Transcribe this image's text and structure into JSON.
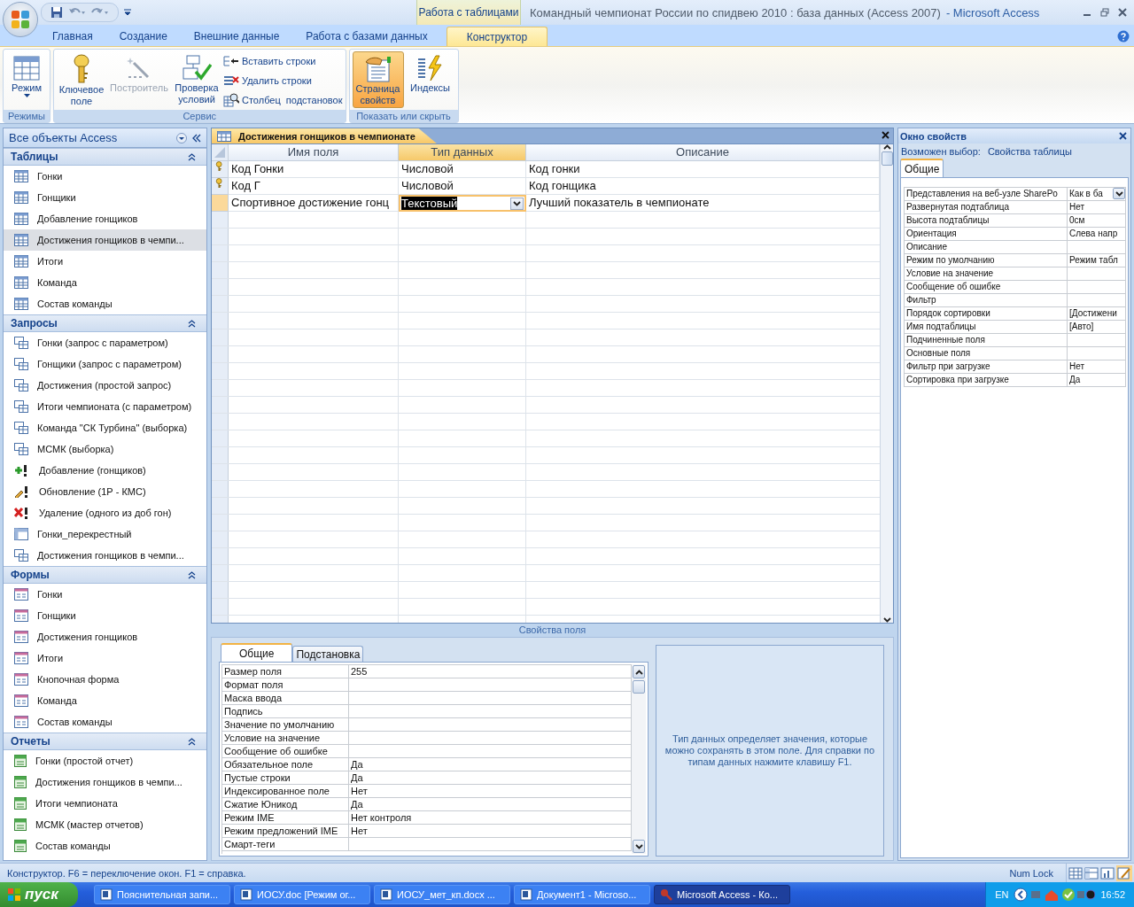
{
  "window": {
    "context_group": "Работа с таблицами",
    "title": "Командный чемпионат России по спидвею 2010 : база данных (Access 2007)",
    "app_name": "- Microsoft Access"
  },
  "ribbon_tabs": [
    {
      "label": "Главная",
      "selected": false
    },
    {
      "label": "Создание",
      "selected": false
    },
    {
      "label": "Внешние данные",
      "selected": false
    },
    {
      "label": "Работа с базами данных",
      "selected": false
    },
    {
      "label": "Конструктор",
      "selected": true
    }
  ],
  "ribbon_groups": [
    {
      "label": "Режимы",
      "items": [
        {
          "label": "Режим",
          "kind": "large",
          "disabled": false,
          "selected": false
        }
      ]
    },
    {
      "label": "Сервис",
      "items": [
        {
          "label": "Ключевое поле",
          "kind": "large",
          "disabled": false,
          "selected": false
        },
        {
          "label": "Построитель",
          "kind": "large",
          "disabled": true,
          "selected": false
        },
        {
          "label": "Проверка условий",
          "kind": "large",
          "disabled": false,
          "selected": false
        },
        {
          "label": "Вставить строки",
          "kind": "small",
          "disabled": false,
          "selected": false
        },
        {
          "label": "Удалить строки",
          "kind": "small",
          "disabled": false,
          "selected": false
        },
        {
          "label": "Столбец  подстановок",
          "kind": "small",
          "disabled": false,
          "selected": false
        }
      ]
    },
    {
      "label": "Показать или скрыть",
      "items": [
        {
          "label": "Страница свойств",
          "kind": "large",
          "disabled": false,
          "selected": true
        },
        {
          "label": "Индексы",
          "kind": "large",
          "disabled": false,
          "selected": false
        }
      ]
    }
  ],
  "nav_pane": {
    "title": "Все объекты Access",
    "sections": [
      {
        "title": "Таблицы",
        "items": [
          {
            "label": "Гонки",
            "kind": "table",
            "selected": false
          },
          {
            "label": "Гонщики",
            "kind": "table",
            "selected": false
          },
          {
            "label": "Добавление гонщиков",
            "kind": "table",
            "selected": false
          },
          {
            "label": "Достижения гонщиков в чемпи...",
            "kind": "table",
            "selected": true
          },
          {
            "label": "Итоги",
            "kind": "table",
            "selected": false
          },
          {
            "label": "Команда",
            "kind": "table",
            "selected": false
          },
          {
            "label": "Состав команды",
            "kind": "table",
            "selected": false
          }
        ]
      },
      {
        "title": "Запросы",
        "items": [
          {
            "label": "Гонки (запрос с параметром)",
            "kind": "query",
            "selected": false
          },
          {
            "label": "Гонщики (запрос с параметром)",
            "kind": "query",
            "selected": false
          },
          {
            "label": "Достижения (простой запрос)",
            "kind": "query",
            "selected": false
          },
          {
            "label": "Итоги чемпионата (с параметром)",
            "kind": "query",
            "selected": false
          },
          {
            "label": "Команда \"СК Турбина\" (выборка)",
            "kind": "query",
            "selected": false
          },
          {
            "label": "МСМК (выборка)",
            "kind": "query",
            "selected": false
          },
          {
            "label": "Добавление (гонщиков)",
            "kind": "append",
            "selected": false
          },
          {
            "label": "Обновление (1Р - КМС)",
            "kind": "update",
            "selected": false
          },
          {
            "label": "Удаление (одного из доб гон)",
            "kind": "delete",
            "selected": false
          },
          {
            "label": "Гонки_перекрестный",
            "kind": "crosstab",
            "selected": false
          },
          {
            "label": "Достижения гонщиков в чемпи...",
            "kind": "query",
            "selected": false
          }
        ]
      },
      {
        "title": "Формы",
        "items": [
          {
            "label": "Гонки",
            "kind": "form",
            "selected": false
          },
          {
            "label": "Гонщики",
            "kind": "form",
            "selected": false
          },
          {
            "label": "Достижения гонщиков",
            "kind": "form",
            "selected": false
          },
          {
            "label": "Итоги",
            "kind": "form",
            "selected": false
          },
          {
            "label": "Кнопочная форма",
            "kind": "form",
            "selected": false
          },
          {
            "label": "Команда",
            "kind": "form",
            "selected": false
          },
          {
            "label": "Состав команды",
            "kind": "form",
            "selected": false
          }
        ]
      },
      {
        "title": "Отчеты",
        "items": [
          {
            "label": "Гонки (простой отчет)",
            "kind": "report",
            "selected": false
          },
          {
            "label": "Достижения гонщиков в чемпи...",
            "kind": "report",
            "selected": false
          },
          {
            "label": "Итоги чемпионата",
            "kind": "report",
            "selected": false
          },
          {
            "label": "МСМК (мастер отчетов)",
            "kind": "report",
            "selected": false
          },
          {
            "label": "Состав команды",
            "kind": "report",
            "selected": false
          }
        ]
      }
    ]
  },
  "document": {
    "tab_title": "Достижения гонщиков в чемпионате",
    "columns": [
      {
        "label": "Имя поля",
        "selected": false
      },
      {
        "label": "Тип данных",
        "selected": true
      },
      {
        "label": "Описание",
        "selected": false
      }
    ],
    "rows": [
      {
        "name": "Код Гонки",
        "type": "Числовой",
        "description": "Код гонки",
        "primary_key": true,
        "selected": false
      },
      {
        "name": "Код Г",
        "type": "Числовой",
        "description": "Код гонщика",
        "primary_key": true,
        "selected": false
      },
      {
        "name": "Спортивное достижение гонц",
        "type": "Текстовый",
        "description": "Лучший показатель в чемпионате",
        "primary_key": false,
        "selected": true
      }
    ]
  },
  "field_properties": {
    "label": "Свойства поля",
    "tabs": [
      {
        "label": "Общие",
        "selected": true
      },
      {
        "label": "Подстановка",
        "selected": false
      }
    ],
    "rows": [
      {
        "name": "Размер поля",
        "value": "255"
      },
      {
        "name": "Формат поля"
      },
      {
        "name": "Маска ввода"
      },
      {
        "name": "Подпись"
      },
      {
        "name": "Значение по умолчанию"
      },
      {
        "name": "Условие на значение"
      },
      {
        "name": "Сообщение об ошибке"
      },
      {
        "name": "Обязательное поле",
        "value": "Да"
      },
      {
        "name": "Пустые строки",
        "value": "Да"
      },
      {
        "name": "Индексированное поле",
        "value": "Нет"
      },
      {
        "name": "Сжатие Юникод",
        "value": "Да"
      },
      {
        "name": "Режим IME",
        "value": "Нет контроля"
      },
      {
        "name": "Режим предложений IME",
        "value": "Нет"
      },
      {
        "name": "Смарт-теги"
      }
    ],
    "help": "Тип данных определяет значения, которые можно сохранять в этом поле.  Для справки по типам данных нажмите клавишу F1."
  },
  "property_sheet": {
    "title": "Окно свойств",
    "selection_label": "Возможен выбор:",
    "selection": "Свойства таблицы",
    "tabs": [
      {
        "label": "Общие",
        "selected": true
      }
    ],
    "rows": [
      {
        "name": "Представления на веб-узле SharePo",
        "value": "Как в ба",
        "kind": "combo"
      },
      {
        "name": "Развернутая подтаблица",
        "value": "Нет",
        "kind": "text"
      },
      {
        "name": "Высота подтаблицы",
        "value": "0см",
        "kind": "text"
      },
      {
        "name": "Ориентация",
        "value": "Слева напр",
        "kind": "text"
      },
      {
        "name": "Описание",
        "kind": "text"
      },
      {
        "name": "Режим по умолчанию",
        "value": "Режим табл",
        "kind": "text"
      },
      {
        "name": "Условие на значение",
        "kind": "text"
      },
      {
        "name": "Сообщение об ошибке",
        "kind": "text"
      },
      {
        "name": "Фильтр",
        "kind": "text"
      },
      {
        "name": "Порядок сортировки",
        "value": "[Достижени",
        "kind": "text"
      },
      {
        "name": "Имя подтаблицы",
        "value": "[Авто]",
        "kind": "text"
      },
      {
        "name": "Подчиненные поля",
        "kind": "text"
      },
      {
        "name": "Основные поля",
        "kind": "text"
      },
      {
        "name": "Фильтр при загрузке",
        "value": "Нет",
        "kind": "text"
      },
      {
        "name": "Сортировка при загрузке",
        "value": "Да",
        "kind": "text"
      }
    ]
  },
  "status_bar": {
    "text": "Конструктор.  F6 = переключение окон.  F1 = справка.",
    "indicator": "Num Lock"
  },
  "taskbar": {
    "start": "пуск",
    "tasks": [
      {
        "label": "Пояснительная запи...",
        "kind": "word",
        "selected": false
      },
      {
        "label": "ИОСУ.doc [Режим ог...",
        "kind": "word",
        "selected": false
      },
      {
        "label": "ИОСУ_мет_кп.docx ...",
        "kind": "word",
        "selected": false
      },
      {
        "label": "Документ1 - Microso...",
        "kind": "word",
        "selected": false
      },
      {
        "label": "Microsoft Access - Ко...",
        "kind": "access",
        "selected": true
      }
    ],
    "language": "EN",
    "clock": "16:52"
  }
}
